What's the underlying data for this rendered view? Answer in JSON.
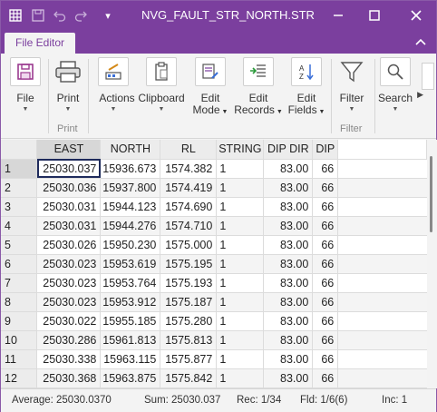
{
  "window": {
    "title": "NVG_FAULT_STR_NORTH.STR",
    "undo_icon": "undo-icon",
    "redo_icon": "redo-icon",
    "save_icon": "save-icon",
    "app_icon": "table-app-icon",
    "colors": {
      "titlebar": "#7b3f9e",
      "active_cell_border": "#1f2b5c"
    }
  },
  "tab": {
    "label": "File Editor"
  },
  "ribbon": {
    "buttons": [
      {
        "label": "File",
        "icon": "save-icon"
      },
      {
        "label": "Print",
        "icon": "printer-icon"
      },
      {
        "label": "Actions",
        "icon": "actions-icon"
      },
      {
        "label": "Clipboard",
        "icon": "clipboard-icon"
      },
      {
        "label": "Edit\nMode",
        "label1": "Edit",
        "label2": "Mode",
        "icon": "edit-mode-icon"
      },
      {
        "label1": "Edit",
        "label2": "Records",
        "icon": "edit-records-icon"
      },
      {
        "label1": "Edit",
        "label2": "Fields",
        "icon": "sort-az-icon"
      },
      {
        "label": "Filter",
        "icon": "filter-icon"
      },
      {
        "label": "Search",
        "icon": "search-icon"
      }
    ],
    "groups": {
      "print": "Print",
      "filter": "Filter"
    }
  },
  "grid": {
    "columns": [
      "EAST",
      "NORTH",
      "RL",
      "STRING",
      "DIP DIR",
      "DIP"
    ],
    "rows": [
      {
        "n": "1",
        "cells": [
          "25030.037",
          "15936.673",
          "1574.382",
          "1",
          "83.00",
          "66"
        ]
      },
      {
        "n": "2",
        "cells": [
          "25030.036",
          "15937.800",
          "1574.419",
          "1",
          "83.00",
          "66"
        ]
      },
      {
        "n": "3",
        "cells": [
          "25030.031",
          "15944.123",
          "1574.690",
          "1",
          "83.00",
          "66"
        ]
      },
      {
        "n": "4",
        "cells": [
          "25030.031",
          "15944.276",
          "1574.710",
          "1",
          "83.00",
          "66"
        ]
      },
      {
        "n": "5",
        "cells": [
          "25030.026",
          "15950.230",
          "1575.000",
          "1",
          "83.00",
          "66"
        ]
      },
      {
        "n": "6",
        "cells": [
          "25030.023",
          "15953.619",
          "1575.195",
          "1",
          "83.00",
          "66"
        ]
      },
      {
        "n": "7",
        "cells": [
          "25030.023",
          "15953.764",
          "1575.193",
          "1",
          "83.00",
          "66"
        ]
      },
      {
        "n": "8",
        "cells": [
          "25030.023",
          "15953.912",
          "1575.187",
          "1",
          "83.00",
          "66"
        ]
      },
      {
        "n": "9",
        "cells": [
          "25030.022",
          "15955.185",
          "1575.280",
          "1",
          "83.00",
          "66"
        ]
      },
      {
        "n": "10",
        "cells": [
          "25030.286",
          "15961.813",
          "1575.813",
          "1",
          "83.00",
          "66"
        ]
      },
      {
        "n": "11",
        "cells": [
          "25030.338",
          "15963.115",
          "1575.877",
          "1",
          "83.00",
          "66"
        ]
      },
      {
        "n": "12",
        "cells": [
          "25030.368",
          "15963.875",
          "1575.842",
          "1",
          "83.00",
          "66"
        ]
      }
    ]
  },
  "status": {
    "average": "Average: 25030.0370",
    "sum": "Sum: 25030.037",
    "rec": "Rec: 1/34",
    "fld": "Fld: 1/6(6)",
    "inc": "Inc: 1"
  }
}
